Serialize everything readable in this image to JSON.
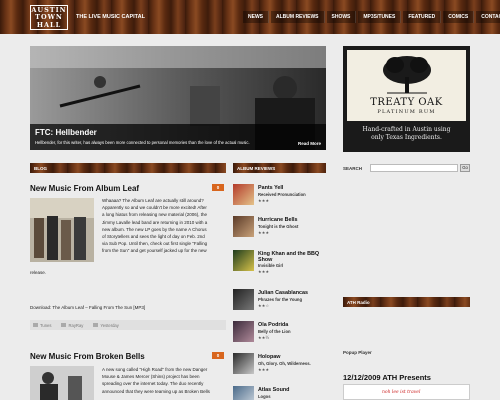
{
  "header": {
    "logo_lines": [
      "AUSTIN",
      "TOWN",
      "HALL"
    ],
    "tagline": "THE LIVE MUSIC CAPITAL",
    "nav": [
      "NEWS",
      "ALBUM REVIEWS",
      "SHOWS",
      "MP3S/TUNES",
      "FEATURED",
      "COMICS",
      "CONTACT"
    ]
  },
  "feature": {
    "title": "FTC: Hellbender",
    "description": "Hellbender, for this writer, has always been more connected to personal memories than the love of the actual music.",
    "more": "Read More"
  },
  "blog": {
    "section_label": "BLOG",
    "post1": {
      "title": "New Music From Album Leaf",
      "comments": "0",
      "lines": [
        "Whaaaa? The Album Leaf are actually still around?",
        "Apparently so and we couldn't be more excited! After",
        "a long hiatus from releasing new material (2006), the",
        "Jimmy Lavalle lead band are returning in 2010 with a",
        "new album. The new LP goes by the name A Chorus",
        "of Storytellers and sees the light of day on Feb. 2nd",
        "via Sub Pop. Until then, check out first single \"Falling",
        "from the Sun\" and get yourself jacked up for the new",
        "release."
      ],
      "download": "Download: The Album Leaf – Falling From The Sun [MP3]",
      "tags": [
        "Tunes",
        "RayRay",
        "Yesterday"
      ]
    },
    "post2": {
      "title": "New Music From Broken Bells",
      "comments": "0",
      "lines": [
        "A new song called \"High Road\" from the new Danger",
        "Mouse & James Mercer (Shins) project has been",
        "spreading over the internet today. The duo recently",
        "announced that they were teaming up as Broken Bells"
      ]
    }
  },
  "albums": {
    "section_label": "ALBUM REVIEWS",
    "items": [
      {
        "title": "Pants Yell",
        "subtitle": "Received Pronunciation",
        "stars": "★★★",
        "art": [
          "#b33a2a",
          "#e4c38a"
        ]
      },
      {
        "title": "Hurricane Bells",
        "subtitle": "Tonight is the Ghost",
        "stars": "★★★",
        "art": [
          "#5a3a28",
          "#c9a27a"
        ]
      },
      {
        "title": "King Khan and the BBQ Show",
        "subtitle": "Invisible Girl",
        "stars": "★★★",
        "art": [
          "#1d3b1d",
          "#d7c24a"
        ]
      },
      {
        "title": "Julian Casablancas",
        "subtitle": "Phrazes for the Young",
        "stars": "★★☆",
        "art": [
          "#222222",
          "#777777"
        ]
      },
      {
        "title": "Ola Podrida",
        "subtitle": "Belly of the Lion",
        "stars": "★★½",
        "art": [
          "#3a2a3a",
          "#b08a9a"
        ]
      },
      {
        "title": "Holopaw",
        "subtitle": "Oh, Glory. Oh, Wilderness.",
        "stars": "★★★",
        "art": [
          "#2a2a2a",
          "#c8c8c8"
        ]
      },
      {
        "title": "Atlas Sound",
        "subtitle": "Logos",
        "stars": "",
        "art": [
          "#4a6a8a",
          "#d0d8e0"
        ]
      }
    ]
  },
  "sidebar": {
    "ad": {
      "brand": "TREATY OAK",
      "sub": "PLATINUM RUM",
      "tag_lines": [
        "Hand-crafted in Austin using",
        "only Texas Ingredients."
      ]
    },
    "search_label": "SEARCH",
    "search_value": "",
    "search_button": "Go",
    "radio_label": "ATH Radio",
    "popup": "Popup Player",
    "presents": "12/12/2009 ATH Presents",
    "poster_text": "noh lee ist travel"
  }
}
